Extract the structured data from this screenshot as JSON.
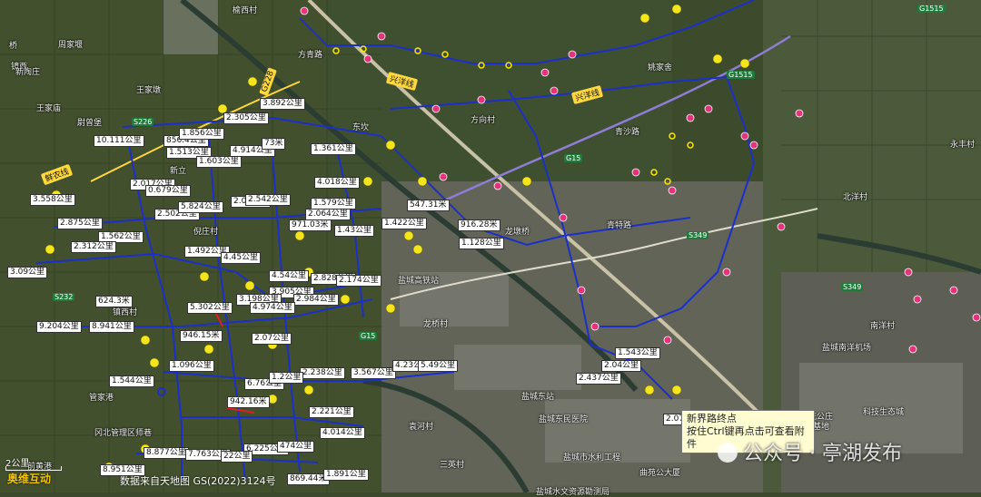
{
  "colors": {
    "route": "#1c2fc9",
    "route_red": "#e02020",
    "dotted": "#ffe600",
    "pin_pink": "#e8317a",
    "marker_yellow": "#f5e61c",
    "road_yellow": "#ffd83b"
  },
  "distance_labels": [
    "3.892公里",
    "2.305公里",
    "856.4公里",
    "1.856公里",
    "10.111公里",
    "1.513公里",
    "4.914公里",
    "1.603公里",
    "73米",
    "1.361公里",
    "2.017公里",
    "0.679公里",
    "4.018公里",
    "3.558公里",
    "2.502公里",
    "5.824公里",
    "2.03公里",
    "2.542公里",
    "1.579公里",
    "2.875公里",
    "1.562公里",
    "971.03米",
    "2.064公里",
    "547.31米",
    "1.422公里",
    "916.28米",
    "2.312公里",
    "1.43公里",
    "1.128公里",
    "1.492公里",
    "4.45公里",
    "3.09公里",
    "4.54公里",
    "2.828公里",
    "2.174公里",
    "3.905公里",
    "2.984公里",
    "624.3米",
    "3.198公里",
    "4.974公里",
    "5.302公里",
    "9.204公里",
    "8.941公里",
    "946.15米",
    "2.07公里",
    "1.543公里",
    "1.096公里",
    "2.04公里",
    "1.544公里",
    "2.238公里",
    "3.567公里",
    "4.23公里",
    "5.49公里",
    "6.76公里",
    "1.2公里",
    "2.437公里",
    "942.16米",
    "2.221公里",
    "4.014公里",
    "6.225公里",
    "474公里",
    "2.076公里",
    "8.877公里",
    "7.763公里",
    "22公里",
    "8.951公里",
    "869.44米",
    "1.891公里"
  ],
  "place_names": [
    "榆西村",
    "方青路",
    "桥",
    "周家堰",
    "镜西",
    "新陶庄",
    "王家墩",
    "王家庙",
    "尉曾堡",
    "东坎",
    "新立",
    "方向村",
    "兴洋线",
    "兴洋线",
    "姚家舍",
    "青沙路",
    "倪庄村",
    "青特路",
    "龙墩桥",
    "龙桥村",
    "北洋村",
    "永丰村",
    "北洋村",
    "南洋村",
    "镇西村",
    "管家港",
    "冈北管理区师巷",
    "盐城高铁站",
    "盐城南洋机场",
    "盐城东站",
    "盐城东民医院",
    "盐城市水利工程",
    "盐城水文资源勘测局",
    "三英村",
    "袁河村",
    "曲苑公大厦",
    "花公庄",
    "城基地",
    "科技生态城",
    "前黄港"
  ],
  "road_labels": [
    "兴洋线",
    "兴洋线",
    "鲜农线",
    "G228"
  ],
  "highway_shields": [
    "G1515",
    "G1515",
    "G15",
    "G15",
    "S226",
    "S349",
    "S232",
    "S349"
  ],
  "tooltip": {
    "title": "新界路终点",
    "hint": "按住Ctrl键再点击可查看附件"
  },
  "scale": {
    "label": "2公里"
  },
  "credit": "数据来自天地图 GS(2022)3124号",
  "brand": "奥维互动",
  "watermark": "公众号 · 亭湖发布"
}
